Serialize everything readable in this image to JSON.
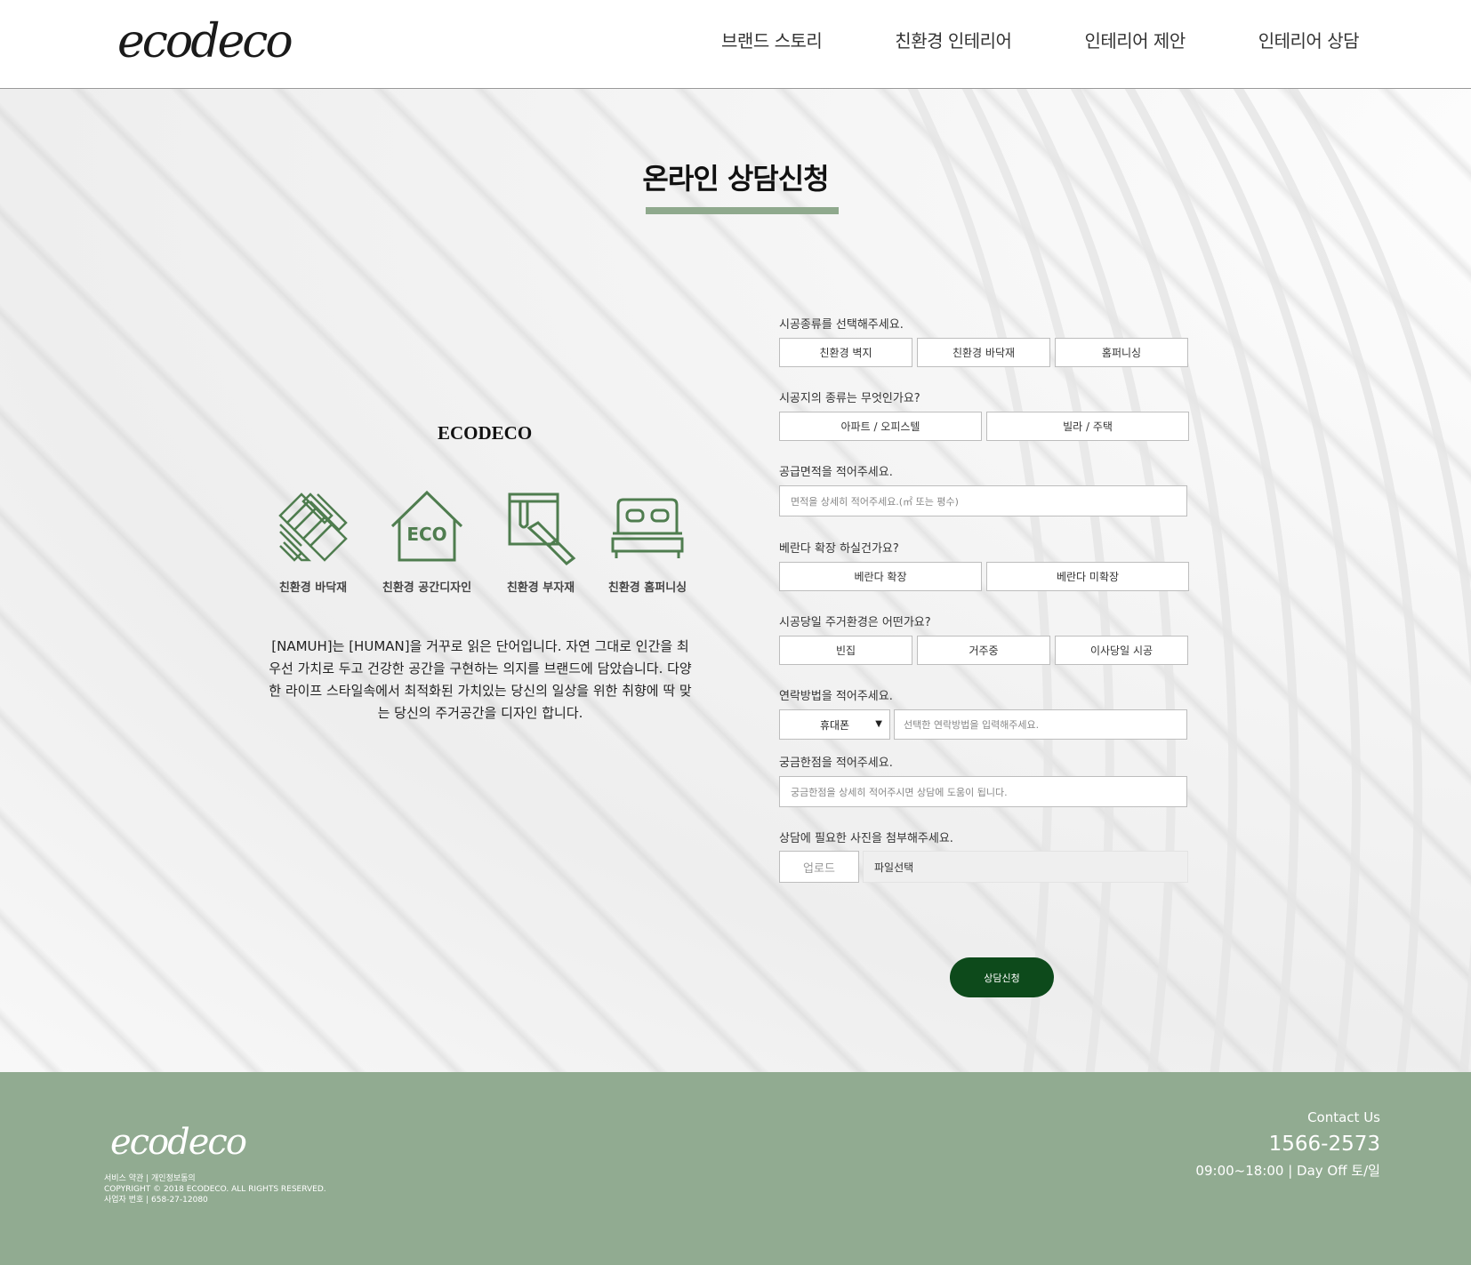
{
  "header": {
    "logo_text": "ecodeco",
    "nav": [
      {
        "label": "브랜드 스토리"
      },
      {
        "label": "친환경 인테리어"
      },
      {
        "label": "인테리어 제안"
      },
      {
        "label": "인테리어 상담"
      }
    ]
  },
  "main": {
    "title": "온라인 상담신청",
    "brand": "ECODECO",
    "features": [
      {
        "label": "친환경 바닥재",
        "icon": "parquet-floor-icon"
      },
      {
        "label": "친환경 공간디자인",
        "icon": "eco-house-icon"
      },
      {
        "label": "친환경 부자재",
        "icon": "paint-bucket-brush-icon"
      },
      {
        "label": "친환경 홈퍼니싱",
        "icon": "bed-icon"
      }
    ],
    "eco_badge": "ECO",
    "intro": "[NAMUH]는 [HUMAN]을 거꾸로 읽은 단어입니다. 자연 그대로 인간을 최우선 가치로 두고 건강한 공간을 구현하는 의지를 브랜드에 담았습니다. 다양한 라이프 스타일속에서 최적화된 가치있는 당신의 일상을 위한 취향에 딱 맞는 당신의 주거공간을 디자인 합니다."
  },
  "form": {
    "q1": "시공종류를 선택해주세요.",
    "q1_options": [
      "친환경 벽지",
      "친환경 바닥재",
      "홈퍼니싱"
    ],
    "q2": "시공지의 종류는 무엇인가요?",
    "q2_options": [
      "아파트 / 오피스텔",
      "빌라 / 주택"
    ],
    "q3": "공급면적을 적어주세요.",
    "q3_placeholder": "면적을 상세히 적어주세요.(㎡ 또는 평수)",
    "q4": "베란다 확장 하실건가요?",
    "q4_options": [
      "베란다 확장",
      "베란다 미확장"
    ],
    "q5": "시공당일 주거환경은 어떤가요?",
    "q5_options": [
      "빈집",
      "거주중",
      "이사당일 시공"
    ],
    "q6": "연락방법을 적어주세요.",
    "q6_select": "휴대폰",
    "q6_placeholder": "선택한 연락방법을 입력해주세요.",
    "q7": "궁금한점을 적어주세요.",
    "q7_placeholder": "궁금한점을 상세히 적어주시면 상담에 도움이 됩니다.",
    "q8": "상담에 필요한 사진을 첨부해주세요.",
    "upload_label": "업로드",
    "file_label": "파일선택",
    "submit_label": "상담신청"
  },
  "footer": {
    "logo_text": "ecodeco",
    "line1": "서비스 약관   |   개인정보동의",
    "line2": "COPYRIGHT © 2018 ECODECO. ALL RIGHTS RESERVED.",
    "line3": "사업자 번호   |   658-27-12080",
    "contact_label": "Contact Us",
    "phone": "1566-2573",
    "hours": "09:00~18:00   |   Day Off 토/일"
  },
  "colors": {
    "accent": "#8fa98d",
    "footer_bg": "#91ab91",
    "icon_green": "#4f7d4f",
    "submit_bg": "#0d4a1b"
  }
}
